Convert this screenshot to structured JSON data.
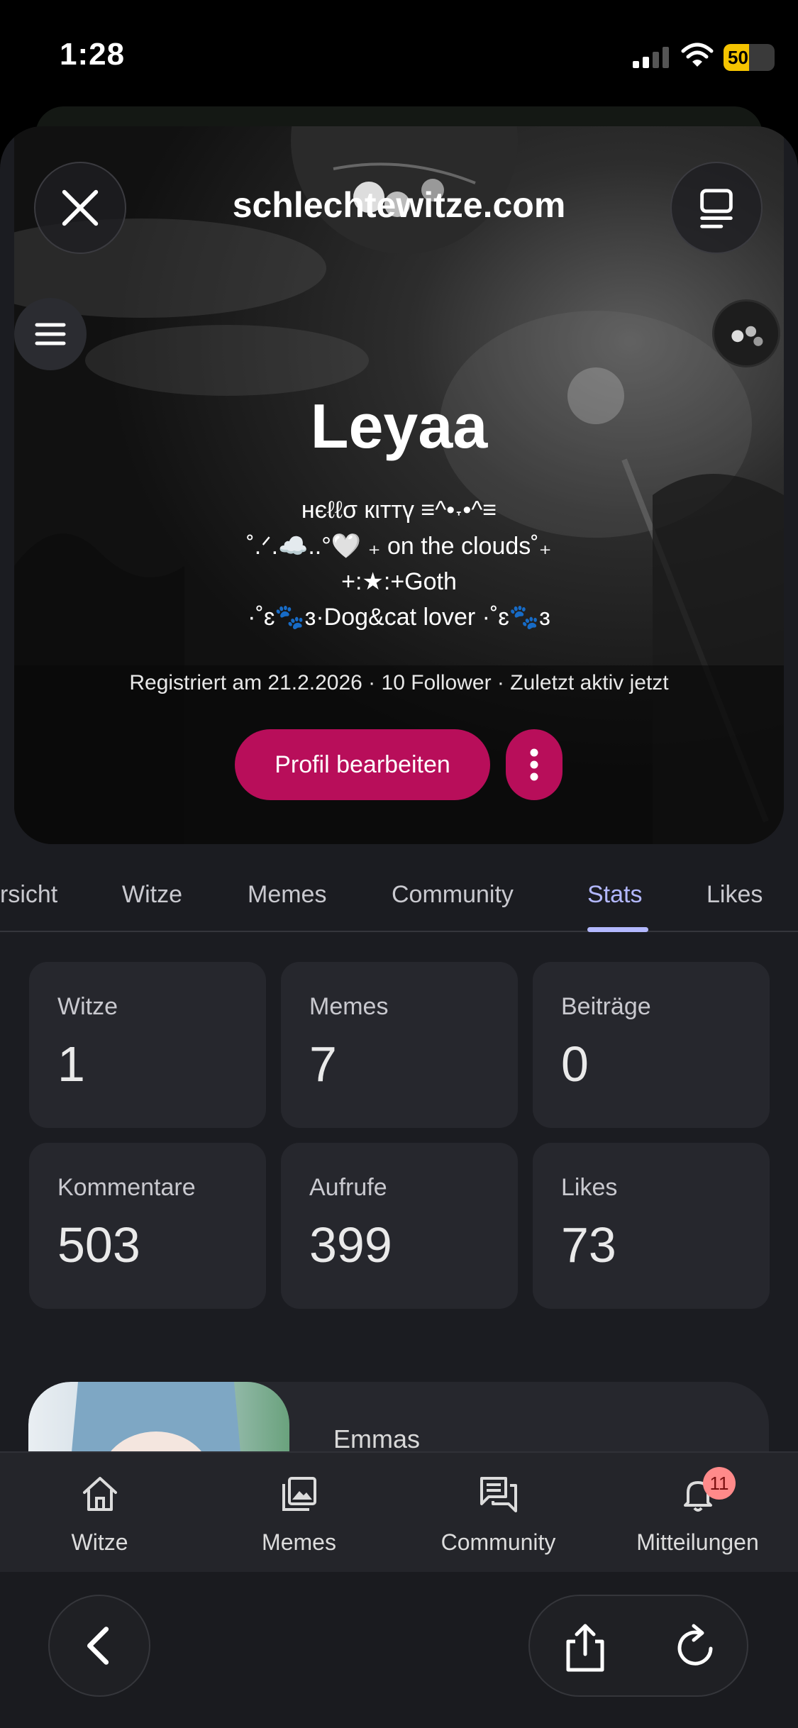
{
  "status_bar": {
    "time": "1:28",
    "battery": "50",
    "battery_level": 0.5
  },
  "browser": {
    "url_title": "schlechtewitze.com"
  },
  "profile": {
    "name": "Leyaa",
    "bio_lines": [
      "нєℓℓσ кιттү ≡^•˕•^≡",
      "˚.ᐟ.☁️..°🤍 ₊ on the clouds˚₊",
      "+:★:+Goth",
      "·˚ɛ🐾ɜ·Dog&cat lover ·˚ɛ🐾ɜ"
    ],
    "meta": "Registriert am 21.2.2026 · 10 Follower · Zuletzt aktiv jetzt",
    "edit_button": "Profil bearbeiten"
  },
  "tabs": [
    {
      "label": "rsicht"
    },
    {
      "label": "Witze"
    },
    {
      "label": "Memes"
    },
    {
      "label": "Community"
    },
    {
      "label": "Stats",
      "active": true
    },
    {
      "label": "Likes"
    }
  ],
  "stats": [
    {
      "label": "Witze",
      "value": "1"
    },
    {
      "label": "Memes",
      "value": "7"
    },
    {
      "label": "Beiträge",
      "value": "0"
    },
    {
      "label": "Kommentare",
      "value": "503"
    },
    {
      "label": "Aufrufe",
      "value": "399"
    },
    {
      "label": "Likes",
      "value": "73"
    }
  ],
  "lower_card": {
    "title": "Emmas"
  },
  "bottom_nav": [
    {
      "label": "Witze",
      "icon": "home-icon"
    },
    {
      "label": "Memes",
      "icon": "gallery-icon"
    },
    {
      "label": "Community",
      "icon": "chat-icon"
    },
    {
      "label": "Mitteilungen",
      "icon": "bell-icon",
      "badge": "11"
    }
  ],
  "colors": {
    "accent": "#b80e5a",
    "tab_active": "#b3b8ff",
    "background": "#1b1c21",
    "card": "#26272d"
  }
}
